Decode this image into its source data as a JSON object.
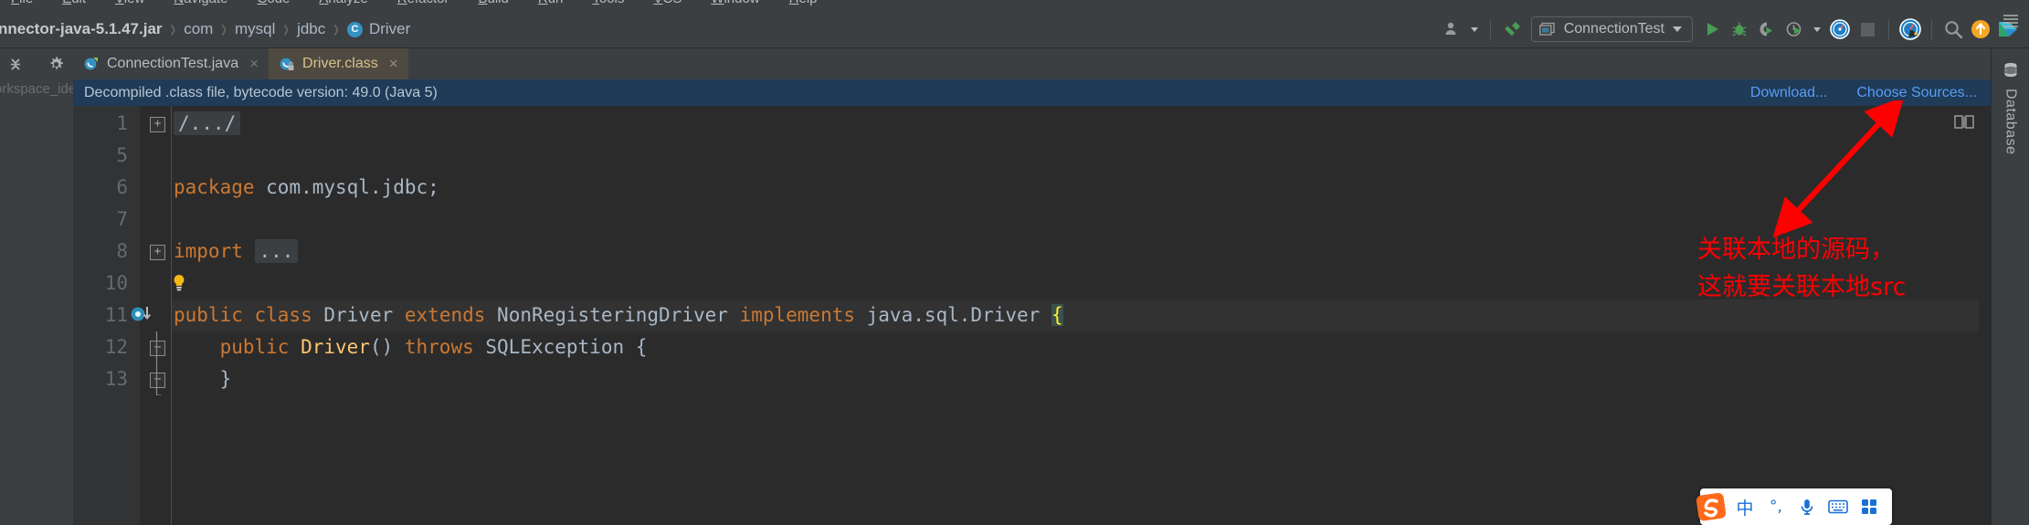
{
  "menu": {
    "items": [
      "File",
      "Edit",
      "View",
      "Navigate",
      "Code",
      "Analyze",
      "Refactor",
      "Build",
      "Run",
      "Tools",
      "VCS",
      "Window",
      "Help"
    ]
  },
  "breadcrumb": {
    "items": [
      {
        "label": "nnector-java-5.1.47.jar",
        "icon": ""
      },
      {
        "label": "com",
        "icon": ""
      },
      {
        "label": "mysql",
        "icon": ""
      },
      {
        "label": "jdbc",
        "icon": ""
      },
      {
        "label": "Driver",
        "icon": "class-icon",
        "icon_letter": "C"
      }
    ],
    "separator": "›"
  },
  "toolbar": {
    "user_icon": "user-avatar-icon",
    "hammer_icon": "build-hammer-icon",
    "run_config": {
      "label": "ConnectionTest",
      "icon": "run-config-window-icon"
    },
    "buttons": [
      {
        "name": "run-button",
        "icon": "run-triangle-icon"
      },
      {
        "name": "debug-button",
        "icon": "debug-bug-icon"
      },
      {
        "name": "run-with-coverage-button",
        "icon": "coverage-icon"
      },
      {
        "name": "profile-button",
        "icon": "profiler-clock-icon"
      },
      {
        "name": "profile-dropdown",
        "icon": "chevron-down-icon"
      },
      {
        "name": "attach-profiler-button",
        "icon": "gauge-blue-icon"
      },
      {
        "name": "stop-button",
        "icon": "stop-square-icon"
      },
      {
        "name": "profiler-status-button",
        "icon": "gauge-cat-icon"
      },
      {
        "name": "search-everywhere-button",
        "icon": "search-icon"
      },
      {
        "name": "update-project-button",
        "icon": "update-arrow-up-icon"
      },
      {
        "name": "ide-logo",
        "icon": "intellij-logo-icon"
      }
    ]
  },
  "left_strip": {
    "icons": [
      {
        "name": "collapse-all-icon"
      },
      {
        "name": "settings-gear-icon"
      },
      {
        "name": "hide-minimize-icon"
      }
    ],
    "ghost_label": "orkspace_ide"
  },
  "tabs": [
    {
      "label": "ConnectionTest.java",
      "icon": "java-class-icon",
      "active": false,
      "close": "×"
    },
    {
      "label": "Driver.class",
      "icon": "decompiled-class-icon",
      "active": true,
      "close": "×"
    }
  ],
  "banner": {
    "text": "Decompiled .class file, bytecode version: 49.0 (Java 5)",
    "links": [
      "Download...",
      "Choose Sources..."
    ]
  },
  "editor": {
    "lines": [
      {
        "num": "1",
        "fold": "+",
        "segments": [
          {
            "t": "/.../",
            "c": "fold-ph"
          }
        ]
      },
      {
        "num": "5",
        "fold": "",
        "segments": []
      },
      {
        "num": "6",
        "fold": "",
        "segments": [
          {
            "t": "package ",
            "c": "kw"
          },
          {
            "t": "com.mysql.jdbc;",
            "c": "typ"
          }
        ]
      },
      {
        "num": "7",
        "fold": "",
        "segments": []
      },
      {
        "num": "8",
        "fold": "+",
        "segments": [
          {
            "t": "import ",
            "c": "kw"
          },
          {
            "t": "...",
            "c": "fold-ph"
          }
        ]
      },
      {
        "num": "10",
        "fold": "",
        "segments": []
      },
      {
        "num": "11",
        "fold": "",
        "segments": [
          {
            "t": "public class ",
            "c": "kw"
          },
          {
            "t": "Driver ",
            "c": "typ"
          },
          {
            "t": "extends ",
            "c": "kw"
          },
          {
            "t": "NonRegisteringDriver ",
            "c": "typ"
          },
          {
            "t": "implements ",
            "c": "kw"
          },
          {
            "t": "java.sql.Driver ",
            "c": "typ"
          },
          {
            "t": "{",
            "c": "brace-hl"
          }
        ]
      },
      {
        "num": "12",
        "fold": "-",
        "segments": [
          {
            "t": "    public ",
            "c": "kw"
          },
          {
            "t": "Driver",
            "c": "meth"
          },
          {
            "t": "() ",
            "c": "typ"
          },
          {
            "t": "throws ",
            "c": "kw"
          },
          {
            "t": "SQLException {",
            "c": "typ"
          }
        ]
      },
      {
        "num": "13",
        "fold": "-",
        "segments": [
          {
            "t": "    }",
            "c": "typ"
          }
        ]
      }
    ],
    "gutter_icons": [
      {
        "name": "implementing-method-marker",
        "line": "11"
      },
      {
        "name": "intention-bulb-icon",
        "line": "10"
      }
    ]
  },
  "annotation": {
    "line1": "关联本地的源码，",
    "line2": "这就要关联本地src",
    "color": "#ff0000",
    "arrow": "red-arrow-pointing-to-choose-sources"
  },
  "right_strip": {
    "label": "Database",
    "icon": "database-cylinder-icon",
    "menu_icon": "hamburger-menu-icon"
  },
  "ime": {
    "logo": "sogou-pinyin-logo",
    "buttons": [
      {
        "name": "ime-language-mode",
        "glyph": "中"
      },
      {
        "name": "ime-punctuation-mode",
        "glyph": "°,"
      },
      {
        "name": "ime-voice-input",
        "glyph": "mic-icon"
      },
      {
        "name": "ime-soft-keyboard",
        "glyph": "keyboard-icon"
      },
      {
        "name": "ime-toolbox",
        "glyph": "grid-apps-icon"
      }
    ]
  },
  "colors": {
    "accent_blue": "#589df6",
    "banner_bg": "#1f3b57",
    "annotation_red": "#ff0000",
    "keyword_orange": "#cc7832",
    "editor_bg": "#2b2b2b"
  }
}
